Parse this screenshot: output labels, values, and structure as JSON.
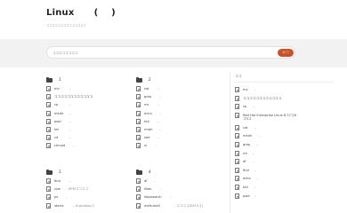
{
  "header": {
    "title": "Linux      (    )",
    "subtitle": "ココココココココココココココ"
  },
  "search": {
    "placeholder": "ココココココココ",
    "button_label": "Q ☐"
  },
  "groups": [
    {
      "num": "1",
      "items": [
        {
          "name": "mv",
          "desc": "–"
        },
        {
          "name": "ココココココココココココ",
          "desc": ""
        },
        {
          "name": "cp",
          "desc": "–"
        },
        {
          "name": "mkdir",
          "desc": "–"
        },
        {
          "name": "pwd",
          "desc": "–"
        },
        {
          "name": "tar",
          "desc": "–"
        },
        {
          "name": "cd",
          "desc": "–"
        },
        {
          "name": "chmod",
          "desc": "–"
        }
      ]
    },
    {
      "num": "2",
      "items": [
        {
          "name": "cat",
          "desc": "–"
        },
        {
          "name": "grep",
          "desc": "–"
        },
        {
          "name": "rm",
          "desc": "–"
        },
        {
          "name": "echo",
          "desc": "–"
        },
        {
          "name": "tail",
          "desc": "–"
        },
        {
          "name": "rmdir",
          "desc": "–"
        },
        {
          "name": "sed",
          "desc": "–"
        },
        {
          "name": "vi",
          "desc": "–"
        }
      ]
    },
    {
      "num": "3",
      "items": [
        {
          "name": "find",
          "desc": "–"
        },
        {
          "name": "rpm",
          "desc": "– RPMココココ"
        },
        {
          "name": "ps",
          "desc": "–"
        },
        {
          "name": "startx",
          "desc": "– X-windowコ"
        }
      ]
    },
    {
      "num": "4",
      "items": [
        {
          "name": "df",
          "desc": "–"
        },
        {
          "name": "fdisk",
          "desc": "–"
        },
        {
          "name": "ldapsearch",
          "desc": "–"
        },
        {
          "name": "mkfs.ext4",
          "desc": "– ココココ(EXT4コ)"
        }
      ]
    }
  ],
  "sidebar": {
    "title": "ココ",
    "items": [
      {
        "name": "mv",
        "desc": "–"
      },
      {
        "name": "ココココココココココココ",
        "desc": ""
      },
      {
        "name": "cp",
        "desc": "–"
      },
      {
        "name": "Red Hat Enterprise Linux 8コ7コ6コ5コ",
        "desc": "",
        "tall": true
      },
      {
        "name": "cat",
        "desc": "–"
      },
      {
        "name": "mkdir",
        "desc": "–"
      },
      {
        "name": "grep",
        "desc": "–"
      },
      {
        "name": "rm",
        "desc": "–"
      },
      {
        "name": "df",
        "desc": "–"
      },
      {
        "name": "find",
        "desc": "–"
      },
      {
        "name": "echo",
        "desc": "–"
      },
      {
        "name": "tail",
        "desc": "–"
      },
      {
        "name": "pwd",
        "desc": "–"
      }
    ]
  }
}
